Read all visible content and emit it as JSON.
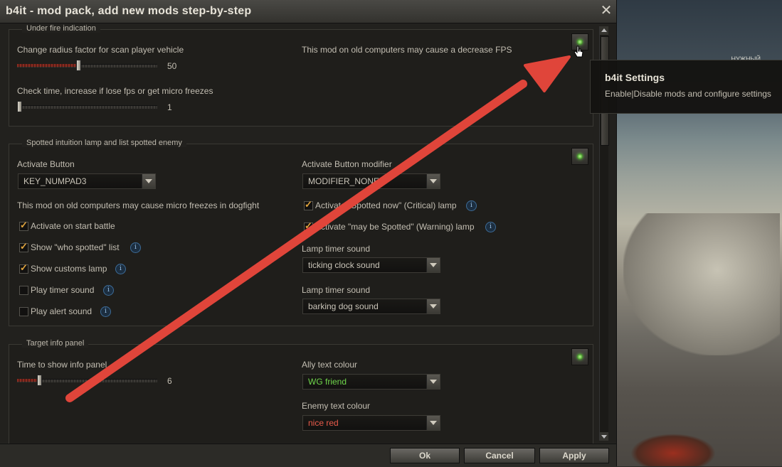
{
  "window": {
    "title": "b4it - mod pack, add new mods step-by-step",
    "close_glyph": "✕"
  },
  "background_hud": {
    "text": "НУЖНЫЙ"
  },
  "sections": {
    "under_fire": {
      "title": "Under fire indication",
      "radius_label": "Change radius factor for scan player vehicle",
      "radius_value": "50",
      "radius_fraction": 0.43,
      "check_label": "Check time, increase if lose fps or get micro freezes",
      "check_value": "1",
      "check_fraction": 0.0,
      "warning": "This mod on old computers may cause a decrease FPS"
    },
    "spotted": {
      "title": "Spotted intuition lamp and list spotted enemy",
      "activate_button_label": "Activate Button",
      "activate_button_value": "KEY_NUMPAD3",
      "modifier_label": "Activate Button modifier",
      "modifier_value": "MODIFIER_NONE",
      "warning": "This mod on old computers may cause micro freezes in dogfight",
      "checks_left": [
        {
          "label": "Activate on start battle",
          "checked": true
        },
        {
          "label": "Show \"who spotted\" list",
          "checked": true
        },
        {
          "label": "Show customs lamp",
          "checked": true
        },
        {
          "label": "Play timer sound",
          "checked": false
        },
        {
          "label": "Play alert sound",
          "checked": false
        }
      ],
      "checks_right": [
        {
          "label": "Activate \"Spotted now\" (Critical) lamp",
          "checked": true
        },
        {
          "label": "Activate \"may be Spotted\" (Warning) lamp",
          "checked": true
        }
      ],
      "lamp_timer_label_1": "Lamp timer sound",
      "lamp_timer_value_1": "ticking clock sound",
      "lamp_timer_label_2": "Lamp timer sound",
      "lamp_timer_value_2": "barking dog sound"
    },
    "target_info": {
      "title": "Target info panel",
      "time_label": "Time to show info panel",
      "time_value": "6",
      "time_fraction": 0.15,
      "ally_label": "Ally text colour",
      "ally_value": "WG friend",
      "enemy_label": "Enemy text colour",
      "enemy_value": "nice red"
    }
  },
  "footer": {
    "ok": "Ok",
    "cancel": "Cancel",
    "apply": "Apply"
  },
  "tooltip": {
    "title": "b4it Settings",
    "body": "Enable|Disable mods and configure settings"
  },
  "colors": {
    "accent_red": "#e0453a",
    "ally_green": "#6fd64b",
    "enemy_red": "#e85a4a",
    "check_orange": "#e0a43d"
  },
  "icons": {
    "info": "i",
    "lamp": "lamp-icon",
    "close": "close-icon"
  }
}
